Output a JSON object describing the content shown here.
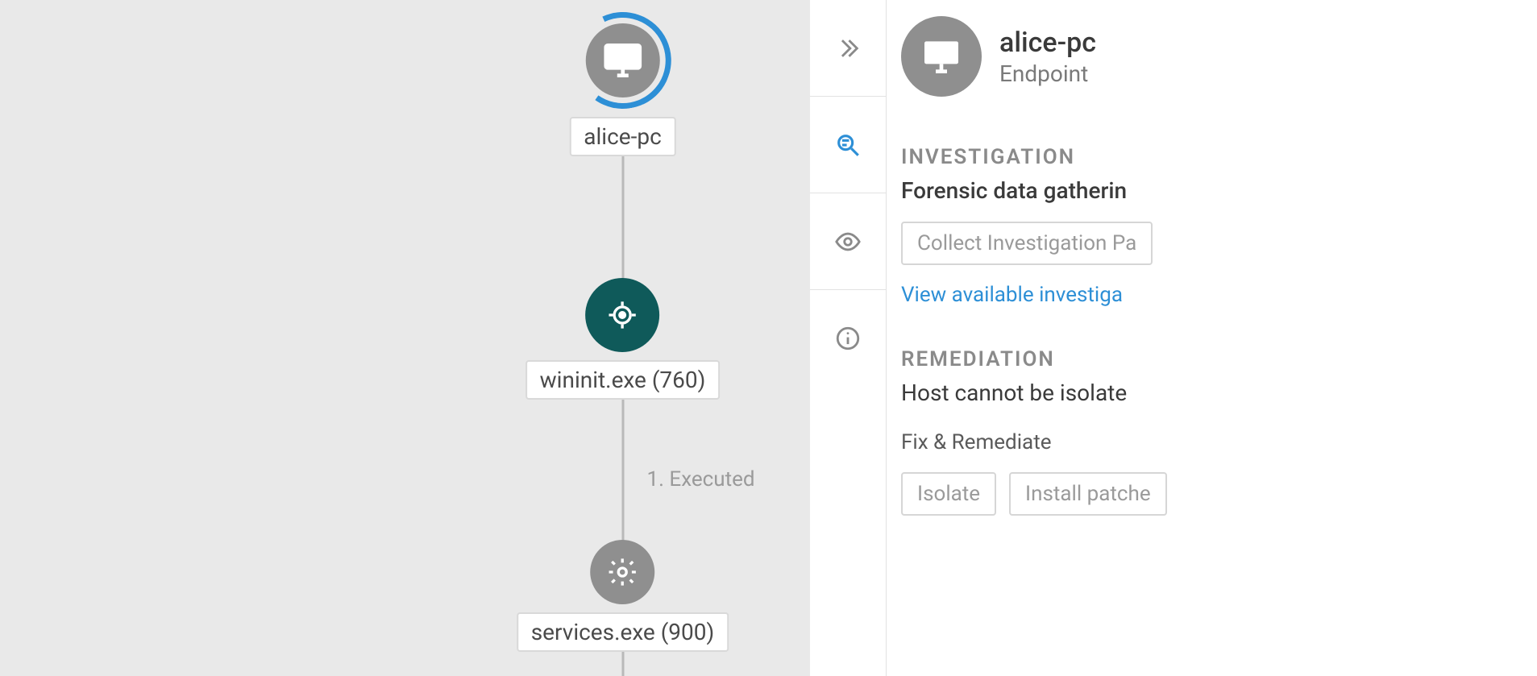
{
  "graph": {
    "nodes": [
      {
        "label": "alice-pc",
        "icon": "monitor",
        "style": "grey-ring"
      },
      {
        "label": "wininit.exe (760)",
        "icon": "target",
        "style": "teal"
      },
      {
        "label": "services.exe (900)",
        "icon": "gear",
        "style": "grey"
      }
    ],
    "edge_label": "1. Executed"
  },
  "tabs": {
    "items": [
      {
        "name": "expand",
        "active": false
      },
      {
        "name": "investigate",
        "active": true
      },
      {
        "name": "view",
        "active": false
      },
      {
        "name": "info",
        "active": false
      }
    ]
  },
  "details": {
    "title": "alice-pc",
    "subtitle": "Endpoint",
    "investigation": {
      "heading": "INVESTIGATION",
      "subheading": "Forensic data gatherin",
      "collect_button": "Collect Investigation Pa",
      "link": "View available investiga"
    },
    "remediation": {
      "heading": "REMEDIATION",
      "status": "Host cannot be isolate",
      "fix_label": "Fix & Remediate",
      "isolate_button": "Isolate",
      "patch_button": "Install patche"
    }
  }
}
